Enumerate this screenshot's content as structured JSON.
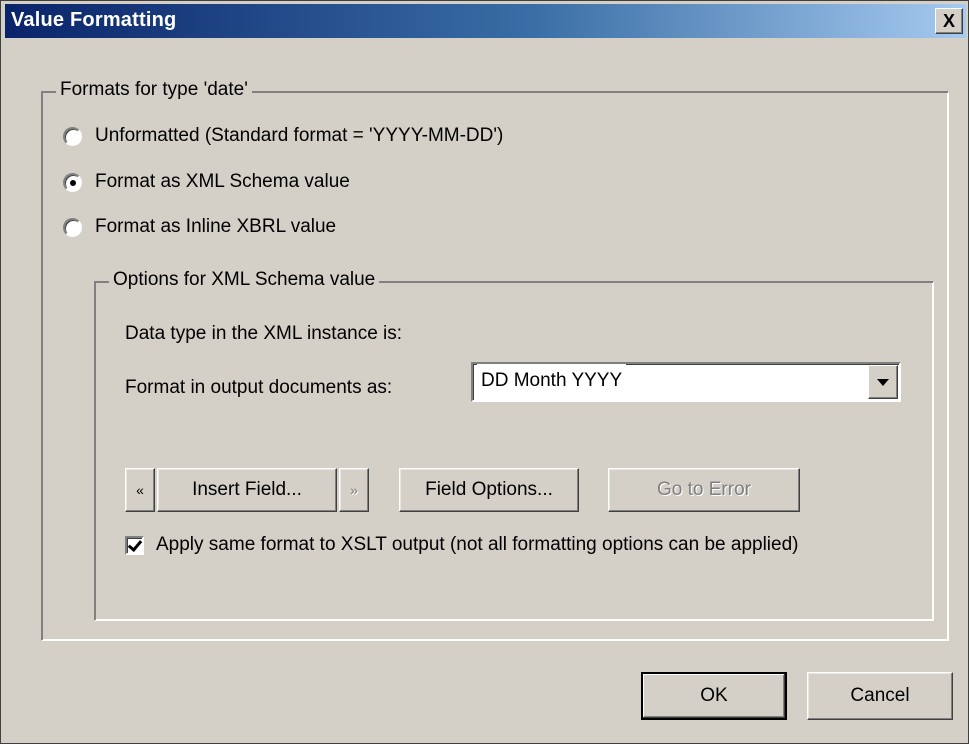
{
  "window": {
    "title": "Value Formatting",
    "close_glyph": "X"
  },
  "formats_group": {
    "legend": "Formats for type 'date'",
    "options": [
      {
        "label": "Unformatted (Standard format = 'YYYY-MM-DD')",
        "checked": false
      },
      {
        "label": "Format as XML Schema value",
        "checked": true
      },
      {
        "label": "Format as Inline XBRL value",
        "checked": false
      }
    ]
  },
  "schema_group": {
    "legend": "Options for XML Schema value",
    "data_type_label": "Data type in the XML instance is:",
    "format_label": "Format in output documents as:",
    "format_select": {
      "value": "DD Month YYYY"
    },
    "buttons": {
      "prev": "«",
      "insert_field": "Insert Field...",
      "next": "»",
      "field_options": "Field Options...",
      "go_to_error": "Go to Error"
    },
    "apply_checkbox": {
      "label": "Apply same format to XSLT output (not all formatting options can be applied)",
      "checked": true
    }
  },
  "footer": {
    "ok": "OK",
    "cancel": "Cancel"
  },
  "icons": {
    "close": "close-icon",
    "dropdown": "chevron-down-icon",
    "check": "checkmark-icon"
  }
}
